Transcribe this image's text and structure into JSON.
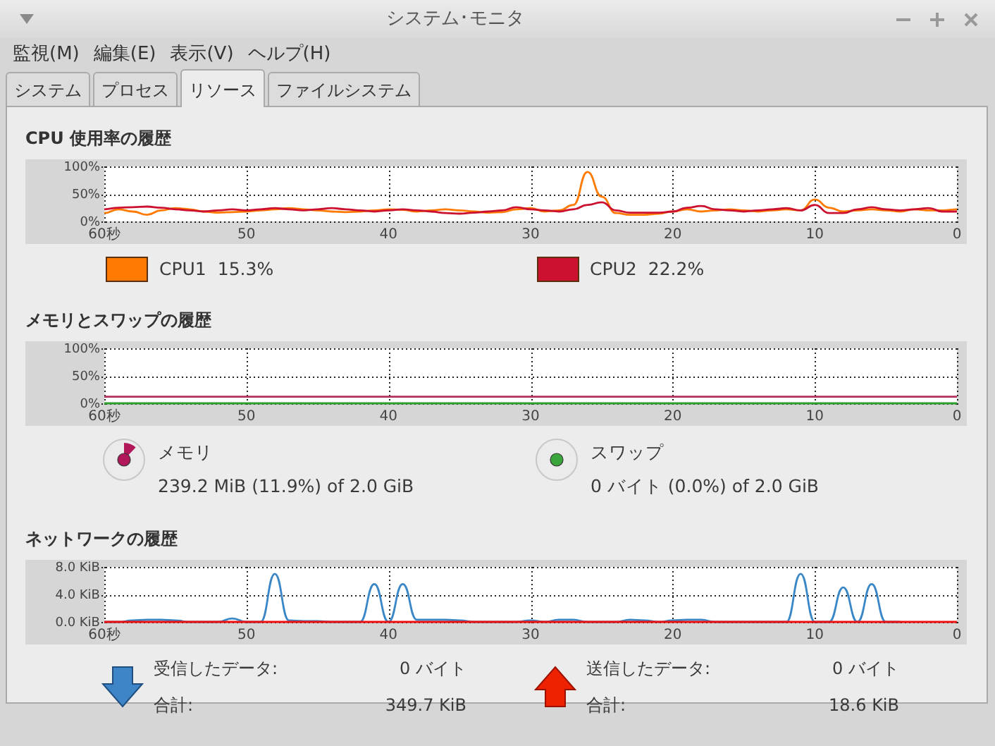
{
  "window": {
    "title": "システム･モニタ"
  },
  "menu": [
    "監視(M)",
    "編集(E)",
    "表示(V)",
    "ヘルプ(H)"
  ],
  "tabs": [
    {
      "label": "システム",
      "selected": false
    },
    {
      "label": "プロセス",
      "selected": false
    },
    {
      "label": "リソース",
      "selected": true
    },
    {
      "label": "ファイルシステム",
      "selected": false
    }
  ],
  "sections": [
    {
      "kind": "cpu",
      "title": "CPU 使用率の履歴",
      "chart_data": {
        "type": "line",
        "grid": true,
        "xlim": [
          60,
          0
        ],
        "ylim": [
          0,
          100
        ],
        "x": [
          60,
          59,
          58,
          57,
          56,
          55,
          54,
          53,
          52,
          51,
          50,
          49,
          48,
          47,
          46,
          45,
          44,
          43,
          42,
          41,
          40,
          39,
          38,
          37,
          36,
          35,
          34,
          33,
          32,
          31,
          30,
          29,
          28,
          27,
          26,
          25,
          24,
          23,
          22,
          21,
          20,
          19,
          18,
          17,
          16,
          15,
          14,
          13,
          12,
          11,
          10,
          9,
          8,
          7,
          6,
          5,
          4,
          3,
          2,
          1,
          0
        ],
        "xticks": [
          {
            "value": 60,
            "label": "60秒"
          },
          {
            "value": 50,
            "label": "50"
          },
          {
            "value": 40,
            "label": "40"
          },
          {
            "value": 30,
            "label": "30"
          },
          {
            "value": 20,
            "label": "20"
          },
          {
            "value": 10,
            "label": "10"
          },
          {
            "value": 0,
            "label": "0"
          }
        ],
        "yticks": [
          {
            "value": 0,
            "label": "0%"
          },
          {
            "value": 50,
            "label": "50%"
          },
          {
            "value": 100,
            "label": "100%"
          }
        ],
        "series": [
          {
            "color": "#ff7a00",
            "values": [
              15,
              22,
              18,
              12,
              20,
              24,
              22,
              18,
              16,
              17,
              18,
              20,
              22,
              24,
              22,
              20,
              18,
              17,
              18,
              20,
              22,
              21,
              18,
              20,
              22,
              20,
              18,
              16,
              17,
              22,
              24,
              18,
              20,
              30,
              90,
              45,
              15,
              12,
              12,
              14,
              18,
              22,
              18,
              20,
              22,
              20,
              18,
              20,
              22,
              20,
              40,
              25,
              18,
              20,
              22,
              20,
              18,
              22,
              20,
              20,
              22
            ]
          },
          {
            "color": "#cc1030",
            "values": [
              22,
              25,
              26,
              27,
              25,
              22,
              20,
              18,
              20,
              22,
              20,
              22,
              24,
              22,
              20,
              22,
              24,
              22,
              20,
              18,
              20,
              22,
              20,
              18,
              15,
              14,
              16,
              18,
              20,
              26,
              22,
              20,
              18,
              22,
              30,
              35,
              20,
              16,
              16,
              16,
              18,
              25,
              28,
              22,
              20,
              18,
              20,
              22,
              24,
              20,
              30,
              15,
              15,
              22,
              26,
              22,
              20,
              22,
              24,
              18,
              18
            ]
          }
        ]
      },
      "legend": [
        {
          "label": "CPU1",
          "value": "15.3%",
          "color": "#ff7a00"
        },
        {
          "label": "CPU2",
          "value": "22.2%",
          "color": "#cc1030"
        }
      ]
    },
    {
      "kind": "memory",
      "title": "メモリとスワップの履歴",
      "chart_data": {
        "type": "line",
        "grid": true,
        "xlim": [
          60,
          0
        ],
        "ylim": [
          0,
          100
        ],
        "x": [
          60,
          0
        ],
        "xticks": [
          {
            "value": 60,
            "label": "60秒"
          },
          {
            "value": 50,
            "label": "50"
          },
          {
            "value": 40,
            "label": "40"
          },
          {
            "value": 30,
            "label": "30"
          },
          {
            "value": 20,
            "label": "20"
          },
          {
            "value": 10,
            "label": "10"
          },
          {
            "value": 0,
            "label": "0"
          }
        ],
        "yticks": [
          {
            "value": 0,
            "label": "0%"
          },
          {
            "value": 50,
            "label": "50%"
          },
          {
            "value": 100,
            "label": "100%"
          }
        ],
        "series": [
          {
            "color": "#b0305a",
            "values": [
              12,
              12
            ]
          },
          {
            "color": "#2ea02e",
            "values": [
              0,
              0
            ]
          }
        ]
      },
      "meters": [
        {
          "kind": "pie",
          "label": "メモリ",
          "value": "239.2 MiB (11.9%) of 2.0 GiB",
          "color": "#b0185a"
        },
        {
          "kind": "dot",
          "label": "スワップ",
          "value": "0 バイト (0.0%) of 2.0 GiB",
          "color": "#3aa53a"
        }
      ]
    },
    {
      "kind": "network",
      "title": "ネットワークの履歴",
      "chart_data": {
        "type": "line",
        "grid": true,
        "xlim": [
          60,
          0
        ],
        "ylim": [
          0,
          8
        ],
        "x": [
          60,
          59,
          58,
          57,
          56,
          55,
          54,
          53,
          52,
          51,
          50,
          49,
          48,
          47,
          46,
          45,
          44,
          43,
          42,
          41,
          40,
          39,
          38,
          37,
          36,
          35,
          34,
          33,
          32,
          31,
          30,
          29,
          28,
          27,
          26,
          25,
          24,
          23,
          22,
          21,
          20,
          19,
          18,
          17,
          16,
          15,
          14,
          13,
          12,
          11,
          10,
          9,
          8,
          7,
          6,
          5,
          4,
          3,
          2,
          1,
          0
        ],
        "xticks": [
          {
            "value": 60,
            "label": "60秒"
          },
          {
            "value": 50,
            "label": "50"
          },
          {
            "value": 40,
            "label": "40"
          },
          {
            "value": 30,
            "label": "30"
          },
          {
            "value": 20,
            "label": "20"
          },
          {
            "value": 10,
            "label": "10"
          },
          {
            "value": 0,
            "label": "0"
          }
        ],
        "yticks": [
          {
            "value": 0,
            "label": "0.0 KiB"
          },
          {
            "value": 4,
            "label": "4.0 KiB"
          },
          {
            "value": 8,
            "label": "8.0 KiB"
          }
        ],
        "series": [
          {
            "color": "#3a87c8",
            "values": [
              0,
              0,
              0.2,
              0.3,
              0.3,
              0.2,
              0,
              0,
              0,
              0.5,
              0,
              0,
              7,
              0.2,
              0.1,
              0.1,
              0,
              0,
              0,
              5.5,
              0,
              5.5,
              0.3,
              0.3,
              0.3,
              0.2,
              0,
              0,
              0,
              0,
              0.2,
              0,
              0.3,
              0.3,
              0,
              0,
              0,
              0.3,
              0.2,
              0,
              0.2,
              0.3,
              0.3,
              0,
              0,
              0,
              0,
              0,
              0,
              7,
              0,
              0,
              5,
              0,
              5.5,
              0,
              0,
              null,
              null,
              null,
              null
            ]
          },
          {
            "color": "#ee1111",
            "values": [
              0,
              0,
              0,
              0,
              0,
              0,
              0,
              0,
              0,
              0,
              0,
              0,
              0,
              0,
              0,
              0,
              0,
              0,
              0,
              0,
              0,
              0,
              0,
              0,
              0,
              0,
              0,
              0,
              0,
              0,
              0,
              0,
              0,
              0,
              0,
              0,
              0,
              0,
              0,
              0,
              0,
              0,
              0,
              0,
              0,
              0,
              0,
              0,
              0,
              0,
              0,
              0,
              0,
              0,
              0,
              0,
              0,
              0,
              0,
              0,
              0
            ]
          }
        ]
      },
      "transfers": [
        {
          "kind": "download",
          "rows": [
            {
              "label": "受信したデータ:",
              "value": "0 バイト"
            },
            {
              "label": "合計:",
              "value": "349.7 KiB"
            }
          ]
        },
        {
          "kind": "upload",
          "rows": [
            {
              "label": "送信したデータ:",
              "value": "0 バイト"
            },
            {
              "label": "合計:",
              "value": "18.6 KiB"
            }
          ]
        }
      ]
    }
  ]
}
